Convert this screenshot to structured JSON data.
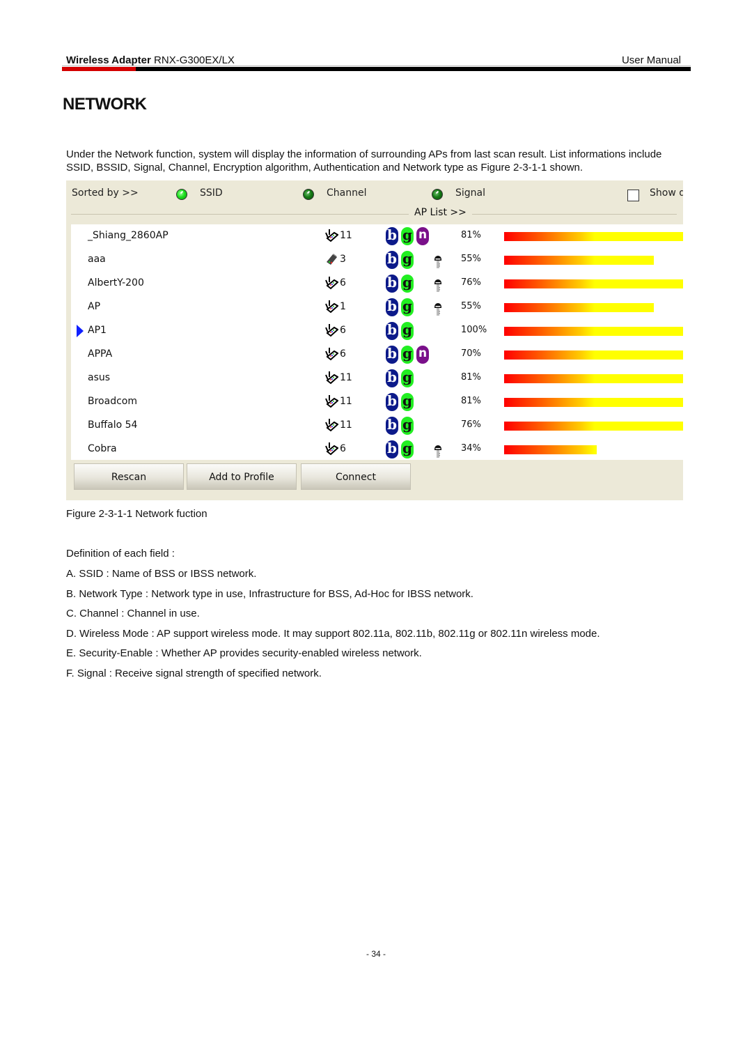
{
  "header": {
    "product_bold": "Wireless Adapter",
    "model": "RNX-G300EX/LX",
    "doc_type": "User Manual"
  },
  "section_title": "NETWORK",
  "intro": "Under the Network function, system will display the information of surrounding APs from last scan result. List informations include SSID, BSSID, Signal, Channel, Encryption algorithm, Authentication and Network type as Figure 2-3-1-1 shown.",
  "panel": {
    "sorted_by_label": "Sorted by >>",
    "sort_options": [
      {
        "label": "SSID",
        "selected": true
      },
      {
        "label": "Channel",
        "selected": false
      },
      {
        "label": "Signal",
        "selected": false
      }
    ],
    "show_checkbox_label": "Show d",
    "show_checked": false,
    "ap_list_label": "AP List >>",
    "colors": {
      "b_badge": "#0c1a8a",
      "g_badge": "#22ee22",
      "n_badge": "#7a108a",
      "selected_arrow": "#1020ff"
    },
    "aps": [
      {
        "ssid": "_Shiang_2860AP",
        "type": "infrastructure",
        "channel": "11",
        "modes": [
          "b",
          "g",
          "n"
        ],
        "secured": false,
        "signal": "81%",
        "signal_value": 81,
        "selected": false
      },
      {
        "ssid": "aaa",
        "type": "ad-hoc",
        "channel": "3",
        "modes": [
          "b",
          "g"
        ],
        "secured": true,
        "signal": "55%",
        "signal_value": 55,
        "selected": false
      },
      {
        "ssid": "AlbertY-200",
        "type": "infrastructure",
        "channel": "6",
        "modes": [
          "b",
          "g"
        ],
        "secured": true,
        "signal": "76%",
        "signal_value": 76,
        "selected": false
      },
      {
        "ssid": "AP",
        "type": "infrastructure",
        "channel": "1",
        "modes": [
          "b",
          "g"
        ],
        "secured": true,
        "signal": "55%",
        "signal_value": 55,
        "selected": false
      },
      {
        "ssid": "AP1",
        "type": "infrastructure",
        "channel": "6",
        "modes": [
          "b",
          "g"
        ],
        "secured": false,
        "signal": "100%",
        "signal_value": 100,
        "selected": true
      },
      {
        "ssid": "APPA",
        "type": "infrastructure",
        "channel": "6",
        "modes": [
          "b",
          "g",
          "n"
        ],
        "secured": false,
        "signal": "70%",
        "signal_value": 70,
        "selected": false
      },
      {
        "ssid": "asus",
        "type": "infrastructure",
        "channel": "11",
        "modes": [
          "b",
          "g"
        ],
        "secured": false,
        "signal": "81%",
        "signal_value": 81,
        "selected": false
      },
      {
        "ssid": "Broadcom",
        "type": "infrastructure",
        "channel": "11",
        "modes": [
          "b",
          "g"
        ],
        "secured": false,
        "signal": "81%",
        "signal_value": 81,
        "selected": false
      },
      {
        "ssid": "Buffalo 54",
        "type": "infrastructure",
        "channel": "11",
        "modes": [
          "b",
          "g"
        ],
        "secured": false,
        "signal": "76%",
        "signal_value": 76,
        "selected": false
      },
      {
        "ssid": "Cobra",
        "type": "infrastructure",
        "channel": "6",
        "modes": [
          "b",
          "g"
        ],
        "secured": true,
        "signal": "34%",
        "signal_value": 34,
        "selected": false
      }
    ],
    "buttons": [
      "Rescan",
      "Add to Profile",
      "Connect"
    ]
  },
  "caption": "Figure 2-3-1-1 Network fuction",
  "definitions_heading": "Definition of each field :",
  "definitions": [
    "A. SSID : Name of BSS or IBSS network.",
    "B. Network Type : Network type in use, Infrastructure for BSS, Ad-Hoc for IBSS network.",
    "C. Channel : Channel in use.",
    "D. Wireless Mode : AP support wireless mode. It may support 802.11a, 802.11b, 802.11g or 802.11n wireless mode.",
    "E. Security-Enable : Whether AP provides security-enabled wireless network.",
    "F. Signal : Receive signal strength of specified network."
  ],
  "page_number": "- 34 -"
}
